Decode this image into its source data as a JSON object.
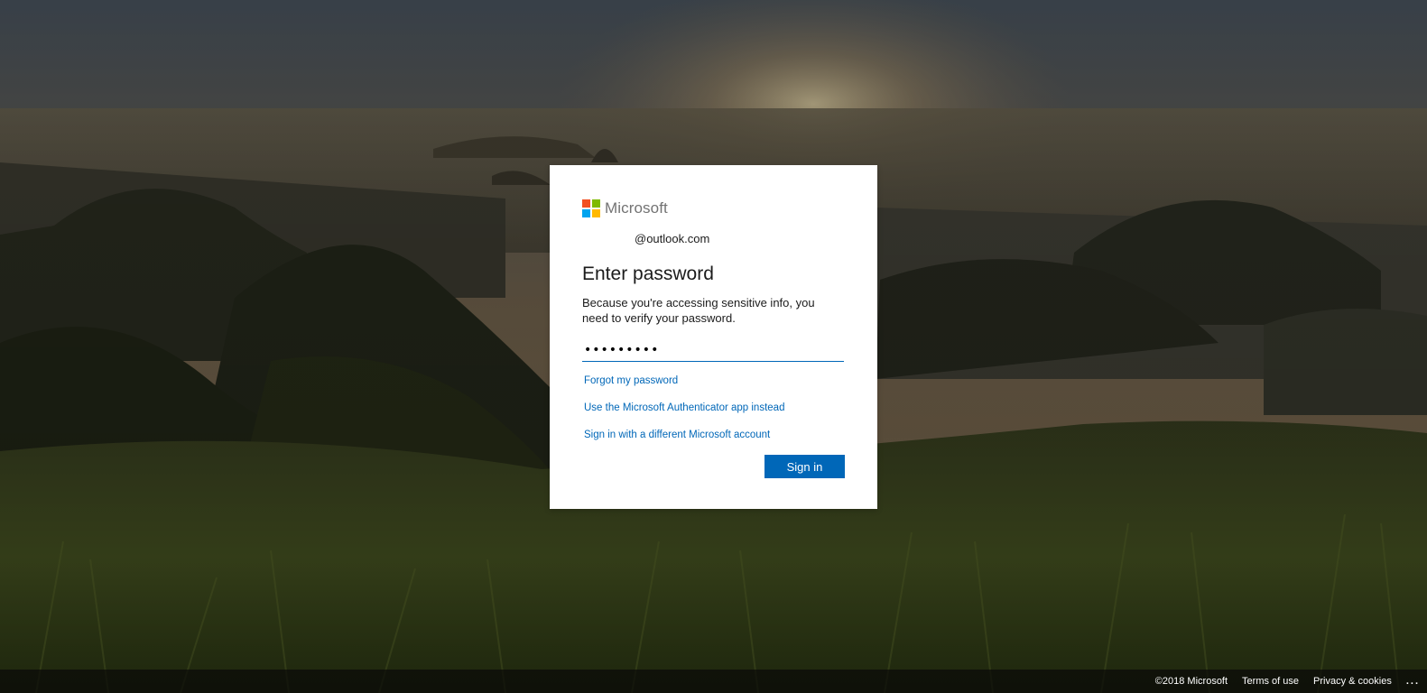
{
  "brand": {
    "name": "Microsoft",
    "logo_colors": [
      "#f25022",
      "#7fba00",
      "#00a4ef",
      "#ffb900"
    ]
  },
  "account": {
    "identity": "@outlook.com"
  },
  "form": {
    "title": "Enter password",
    "description": "Because you're accessing sensitive info, you need to verify your password.",
    "password_value": "•••••••••",
    "forgot_link": "Forgot my password",
    "authenticator_link": "Use the Microsoft Authenticator app instead",
    "different_account_link": "Sign in with a different Microsoft account",
    "signin_button": "Sign in"
  },
  "footer": {
    "copyright": "©2018 Microsoft",
    "terms": "Terms of use",
    "privacy": "Privacy & cookies",
    "more": "..."
  },
  "colors": {
    "accent": "#0067b8"
  }
}
